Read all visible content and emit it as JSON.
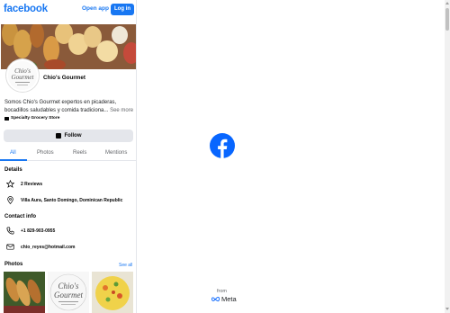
{
  "header": {
    "logo": "facebook",
    "open_app_label": "Open app",
    "login_label": "Log in"
  },
  "profile": {
    "name": "Chio's Gourmet",
    "avatar_text_1": "Chio's",
    "avatar_text_2": "Gourmet",
    "bio": "Somos Chio's Gourmet expertos en picaderas, bocadillos saludables y comida tradiciona...",
    "see_more_label": "See more",
    "category": "Specialty Grocery Store",
    "follow_label": "Follow"
  },
  "tabs": [
    {
      "label": "All"
    },
    {
      "label": "Photos"
    },
    {
      "label": "Reels"
    },
    {
      "label": "Mentions"
    }
  ],
  "details": {
    "title": "Details",
    "reviews": "2 Reviews",
    "address": "Villa Aura, Santo Domingo, Dominican Republic"
  },
  "contact": {
    "title": "Contact info",
    "phone": "+1 829-903-0955",
    "email": "chio_reyes@hotmail.com"
  },
  "photos": {
    "title": "Photos",
    "see_all_label": "See all"
  },
  "footer": {
    "from_label": "from",
    "meta_label": "Meta"
  },
  "colors": {
    "brand_blue": "#1877f2",
    "button_gray": "#e4e6eb",
    "secondary_text": "#65676b"
  },
  "icons": [
    "facebook-logo-icon",
    "star-icon",
    "location-pin-icon",
    "phone-icon",
    "mail-icon",
    "follow-icon",
    "store-icon",
    "meta-infinity-icon"
  ]
}
